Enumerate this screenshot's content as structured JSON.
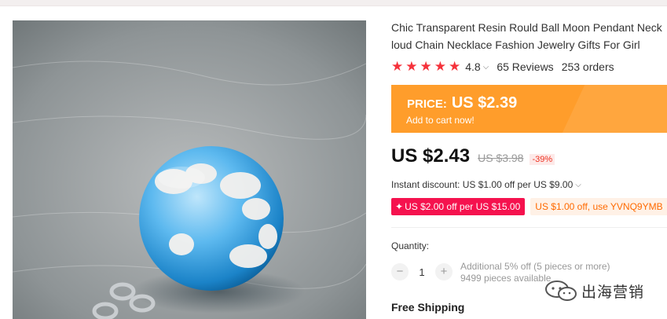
{
  "product": {
    "title_line1": "Chic Transparent Resin Rould Ball Moon Pendant Neck",
    "title_line2": "loud Chain Necklace Fashion Jewelry Gifts For Girl",
    "rating": "4.8",
    "reviews": "65 Reviews",
    "orders": "253 orders"
  },
  "promo": {
    "label": "PRICE:",
    "price": "US $2.39",
    "cta": "Add to cart now!"
  },
  "pricing": {
    "current": "US $2.43",
    "original": "US $3.98",
    "discount": "-39%",
    "instant_discount": "Instant discount: US $1.00 off per US $9.00"
  },
  "coupons": {
    "store": "US $2.00 off per US $15.00",
    "code": "US $1.00 off, use YVNQ9YMB"
  },
  "quantity": {
    "label": "Quantity:",
    "value": "1",
    "note_line1": "Additional 5% off (5 pieces or more)",
    "note_line2": "9499 pieces available"
  },
  "shipping": {
    "label": "Free Shipping"
  },
  "watermark": {
    "text": "出海营销"
  },
  "icons": [
    "star-icon",
    "chevron-down-icon",
    "minus-icon",
    "plus-icon",
    "wechat-icon"
  ],
  "colors": {
    "star": "#f5323b",
    "promo_bg": "#ff9d2b",
    "coupon_red": "#f5124e",
    "coupon_orange_text": "#ff6a00",
    "discount_text": "#e32222"
  }
}
